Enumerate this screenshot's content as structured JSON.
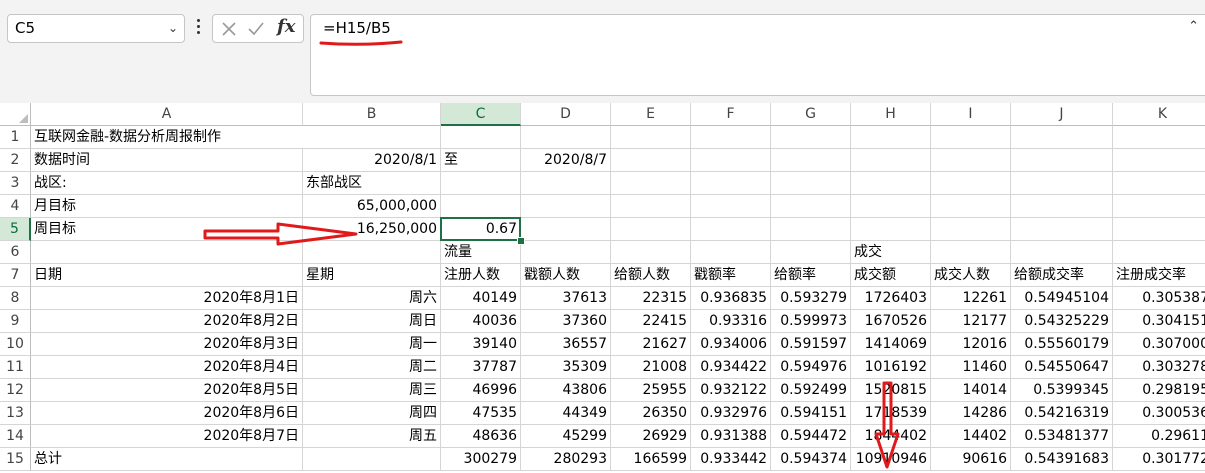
{
  "name_box": {
    "value": "C5"
  },
  "formula_bar": {
    "formula": "=H15/B5"
  },
  "columns": [
    "A",
    "B",
    "C",
    "D",
    "E",
    "F",
    "G",
    "H",
    "I",
    "J",
    "K"
  ],
  "rows": [
    "1",
    "2",
    "3",
    "4",
    "5",
    "6",
    "7",
    "8",
    "9",
    "10",
    "11",
    "12",
    "13",
    "14",
    "15"
  ],
  "active_cell": "C5",
  "sheet": {
    "A1": "互联网金融-数据分析周报制作",
    "A2": "数据时间",
    "B2": "2020/8/1",
    "C2": "至",
    "D2": "2020/8/7",
    "A3": "战区:",
    "B3": "东部战区",
    "A4": "月目标",
    "B4": "65,000,000",
    "A5": "周目标",
    "B5": "16,250,000",
    "C5": "0.67",
    "C6": "流量",
    "H6": "成交",
    "A7": "日期",
    "B7": "星期",
    "C7": "注册人数",
    "D7": "戳额人数",
    "E7": "给额人数",
    "F7": "戳额率",
    "G7": "给额率",
    "H7": "成交额",
    "I7": "成交人数",
    "J7": "给额成交率",
    "K7": "注册成交率",
    "A8": "2020年8月1日",
    "B8": "周六",
    "C8": "40149",
    "D8": "37613",
    "E8": "22315",
    "F8": "0.936835",
    "G8": "0.593279",
    "H8": "1726403",
    "I8": "12261",
    "J8": "0.54945104",
    "K8": "0.305387",
    "A9": "2020年8月2日",
    "B9": "周日",
    "C9": "40036",
    "D9": "37360",
    "E9": "22415",
    "F9": "0.93316",
    "G9": "0.599973",
    "H9": "1670526",
    "I9": "12177",
    "J9": "0.54325229",
    "K9": "0.304151",
    "A10": "2020年8月3日",
    "B10": "周一",
    "C10": "39140",
    "D10": "36557",
    "E10": "21627",
    "F10": "0.934006",
    "G10": "0.591597",
    "H10": "1414069",
    "I10": "12016",
    "J10": "0.55560179",
    "K10": "0.307000",
    "A11": "2020年8月4日",
    "B11": "周二",
    "C11": "37787",
    "D11": "35309",
    "E11": "21008",
    "F11": "0.934422",
    "G11": "0.594976",
    "H11": "1016192",
    "I11": "11460",
    "J11": "0.54550647",
    "K11": "0.303278",
    "A12": "2020年8月5日",
    "B12": "周三",
    "C12": "46996",
    "D12": "43806",
    "E12": "25955",
    "F12": "0.932122",
    "G12": "0.592499",
    "H12": "1520815",
    "I12": "14014",
    "J12": "0.5399345",
    "K12": "0.298195",
    "A13": "2020年8月6日",
    "B13": "周四",
    "C13": "47535",
    "D13": "44349",
    "E13": "26350",
    "F13": "0.932976",
    "G13": "0.594151",
    "H13": "1718539",
    "I13": "14286",
    "J13": "0.54216319",
    "K13": "0.300536",
    "A14": "2020年8月7日",
    "B14": "周五",
    "C14": "48636",
    "D14": "45299",
    "E14": "26929",
    "F14": "0.931388",
    "G14": "0.594472",
    "H14": "1844402",
    "I14": "14402",
    "J14": "0.53481377",
    "K14": "0.29611",
    "A15": "总计",
    "C15": "300279",
    "D15": "280293",
    "E15": "166599",
    "F15": "0.933442",
    "G15": "0.594374",
    "H15": "10910946",
    "I15": "90616",
    "J15": "0.54391683",
    "K15": "0.301772"
  },
  "colors": {
    "accent": "#1e7145",
    "selected_header_bg": "#d3e8d6",
    "annotation_red": "#e0191b",
    "toolbar_bg": "#f3f3f3"
  },
  "icons": [
    "chevron-down-icon",
    "more-options-icon",
    "cancel-icon",
    "enter-icon",
    "fx-icon",
    "collapse-icon",
    "select-all-icon"
  ]
}
